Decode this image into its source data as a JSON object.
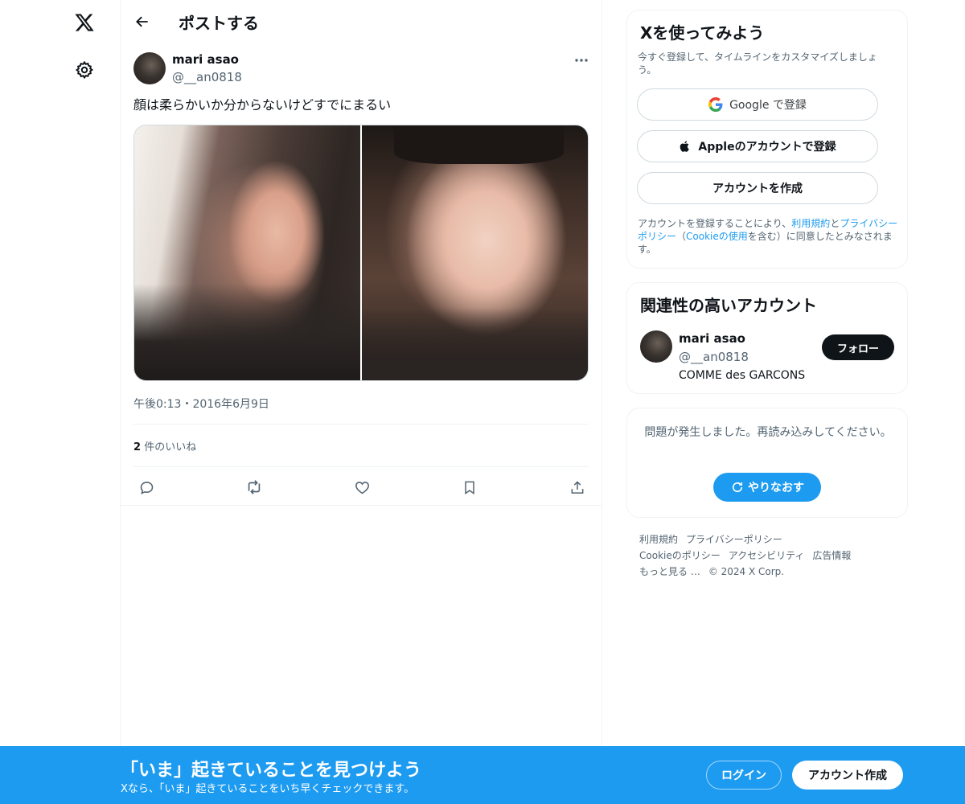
{
  "nav": {
    "logo_icon": "x-logo-icon",
    "settings_icon": "gear-icon"
  },
  "header": {
    "title": "ポストする",
    "back_icon": "arrow-left-icon"
  },
  "tweet": {
    "author_name": "mari asao",
    "author_handle": "@__an0818",
    "text": "顔は柔らかいか分からないけどすでにまるい",
    "time": "午後0:13・2016年6月9日",
    "likes_count": "2",
    "likes_label": "件のいいね",
    "photos": 2
  },
  "signup": {
    "title": "Xを使ってみよう",
    "subtitle": "今すぐ登録して、タイムラインをカスタマイズしましょう。",
    "google_label": "Google で登録",
    "apple_label": "Appleのアカウントで登録",
    "create_label": "アカウントを作成",
    "terms_prefix": "アカウントを登録することにより、",
    "terms_link1": "利用規約",
    "terms_and": "と",
    "terms_link2": "プライバシーポリシー",
    "terms_paren_open": "（",
    "terms_link3": "Cookieの使用",
    "terms_suffix": "を含む）に同意したとみなされます。"
  },
  "related": {
    "title": "関連性の高いアカウント",
    "name": "mari asao",
    "handle": "@__an0818",
    "bio": "COMME des GARCONS",
    "follow_label": "フォロー"
  },
  "error": {
    "message": "問題が発生しました。再読み込みしてください。",
    "retry_label": "やりなおす"
  },
  "footer": {
    "links": [
      "利用規約",
      "プライバシーポリシー",
      "Cookieのポリシー",
      "アクセシビリティ",
      "広告情報",
      "もっと見る …"
    ],
    "copyright": "© 2024 X Corp."
  },
  "bottom_bar": {
    "title": "「いま」起きていることを見つけよう",
    "subtitle": "Xなら、「いま」起きていることをいち早くチェックできます。",
    "login_label": "ログイン",
    "signup_label": "アカウント作成"
  },
  "colors": {
    "accent": "#1d9bf0",
    "text": "#0f1419",
    "secondary": "#536471",
    "border": "#eff3f4"
  }
}
